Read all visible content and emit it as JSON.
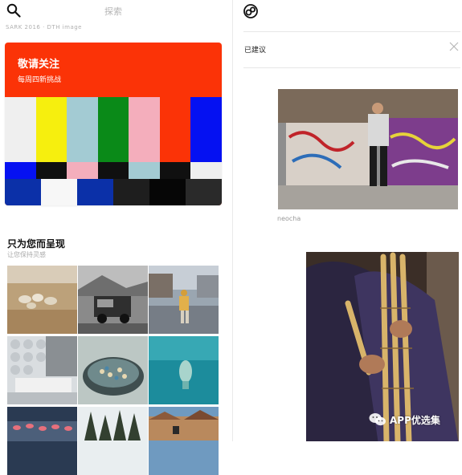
{
  "left_header": {
    "search_hint": "探索",
    "icon": "search-icon",
    "faded_caption": "SARK 2016  ·  DTH image"
  },
  "promo": {
    "title": "敬请关注",
    "subtitle": "每周四新挑战",
    "bg_color": "#fb3307",
    "color_bars_top": [
      "#efefef",
      "#f6ef0e",
      "#a3cbd3",
      "#0a8a18",
      "#f4aebc",
      "#fb3307",
      "#0511f2"
    ],
    "color_bars_mid": [
      "#0511f2",
      "#101010",
      "#f4aebc",
      "#101010",
      "#a3cbd3",
      "#101010",
      "#efefef"
    ],
    "color_bars_bottom": [
      "#0b30a8",
      "#f7f7f7",
      "#0b30a8",
      "#1e1e1e",
      "#060606",
      "#2a2a2a"
    ]
  },
  "section": {
    "title": "只为您而呈现",
    "subtitle": "让您保持灵感"
  },
  "grid_tiles": [
    "sheep-field-photo",
    "vintage-truck-photo",
    "street-performer-photo",
    "bathroom-interior-photo",
    "shell-bowl-photo",
    "swimmer-underwater-photo",
    "flamingos-photo",
    "forest-trees-photo",
    "rooftop-buildings-photo"
  ],
  "right_header": {
    "icon": "eye-logo-icon"
  },
  "suggestion": {
    "label": "已建议",
    "close_icon": "close-icon"
  },
  "photos": [
    {
      "name": "graffiti-wall-photo",
      "caption": "neocha"
    },
    {
      "name": "bamboo-pipes-player-photo",
      "caption": ""
    }
  ],
  "watermark": {
    "text": "APP优选集",
    "icon": "wechat-icon"
  }
}
